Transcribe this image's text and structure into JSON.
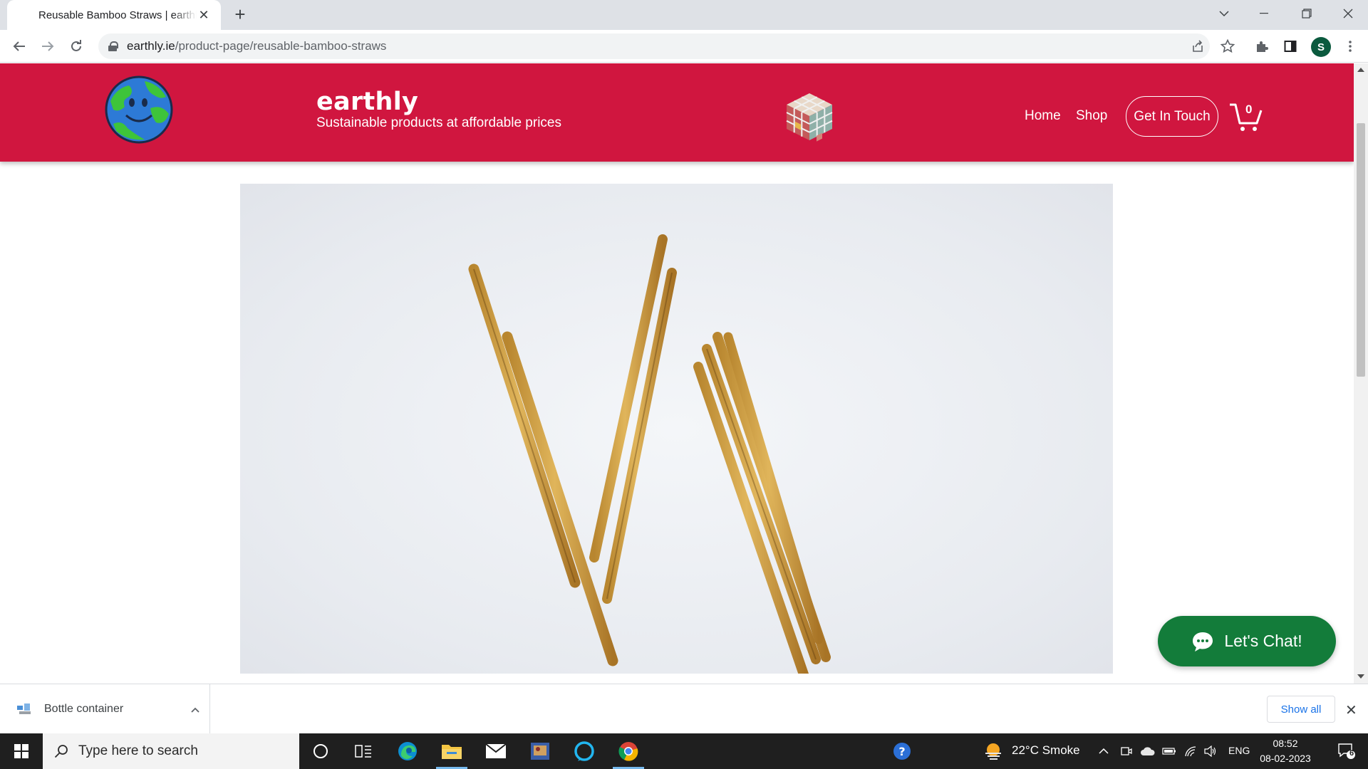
{
  "browser": {
    "tab_title": "Reusable Bamboo Straws | earthly",
    "url_domain": "earthly.ie",
    "url_path": "/product-page/reusable-bamboo-straws",
    "profile_initial": "S"
  },
  "site": {
    "brand_name": "earthly",
    "tagline": "Sustainable products at affordable prices",
    "nav": {
      "home": "Home",
      "shop": "Shop",
      "contact": "Get In Touch"
    },
    "cart_count": "0",
    "colors": {
      "header": "#d0163f",
      "chat": "#137c3a"
    }
  },
  "product": {
    "image_icon": "bamboo-straws-photo"
  },
  "chat": {
    "label": "Let's Chat!"
  },
  "downloads": {
    "item_name": "Bottle container",
    "show_all": "Show all"
  },
  "taskbar": {
    "search_placeholder": "Type here to search",
    "weather": "22°C  Smoke",
    "language": "ENG",
    "time": "08:52",
    "date": "08-02-2023",
    "notifications": "6"
  }
}
